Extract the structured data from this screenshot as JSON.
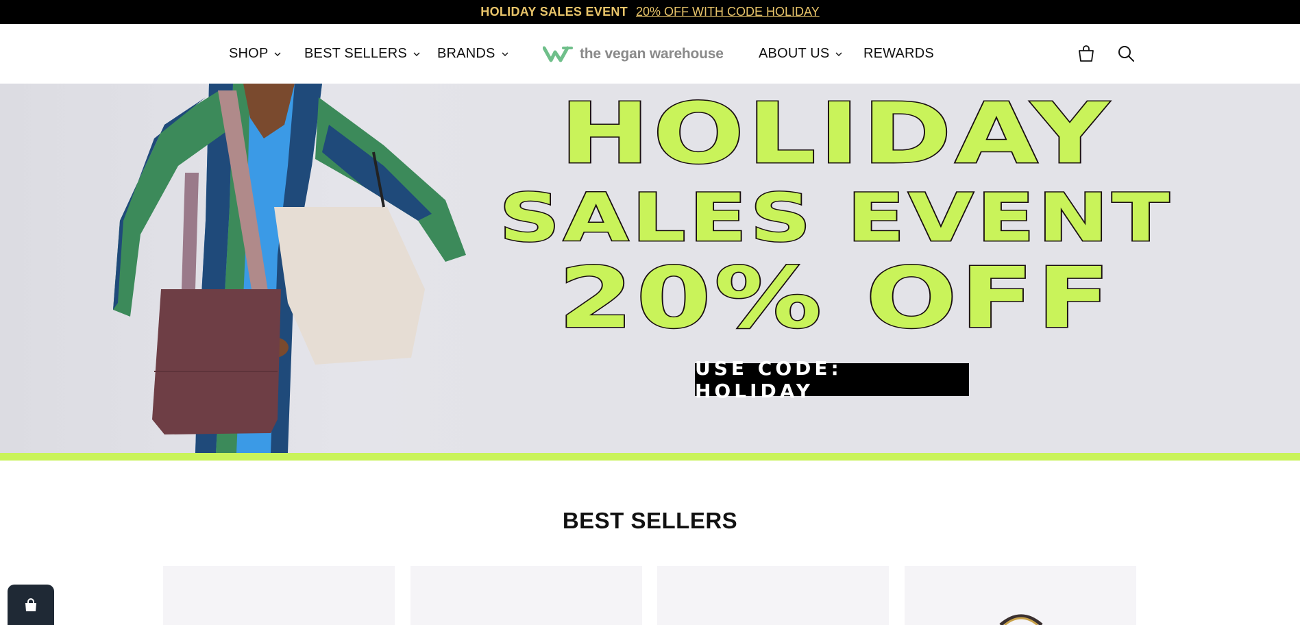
{
  "announcement": {
    "strong_text": "HOLIDAY SALES EVENT",
    "link_text": "20% OFF WITH CODE HOLIDAY"
  },
  "nav": {
    "left_items": [
      {
        "label": "SHOP",
        "has_dropdown": true
      },
      {
        "label": "BEST SELLERS",
        "has_dropdown": true
      },
      {
        "label": "BRANDS",
        "has_dropdown": true
      }
    ],
    "right_items": [
      {
        "label": "ABOUT US",
        "has_dropdown": true
      },
      {
        "label": "REWARDS",
        "has_dropdown": false
      }
    ],
    "logo_text": "the vegan warehouse",
    "icons": [
      "cart-icon",
      "search-icon"
    ]
  },
  "hero": {
    "line1": "HOLIDAY",
    "line2": "SALES EVENT",
    "line3": "20% OFF",
    "code_text": "USE CODE: HOLIDAY"
  },
  "best_sellers": {
    "title": "BEST SELLERS",
    "card_count": 4
  },
  "colors": {
    "announce_bg": "#000000",
    "announce_text": "#e8c46a",
    "accent_lime": "#c9f35a",
    "hero_bg": "#e3e3e8",
    "logo_green": "#6fbf8a",
    "chat_bg": "#1f2935"
  }
}
